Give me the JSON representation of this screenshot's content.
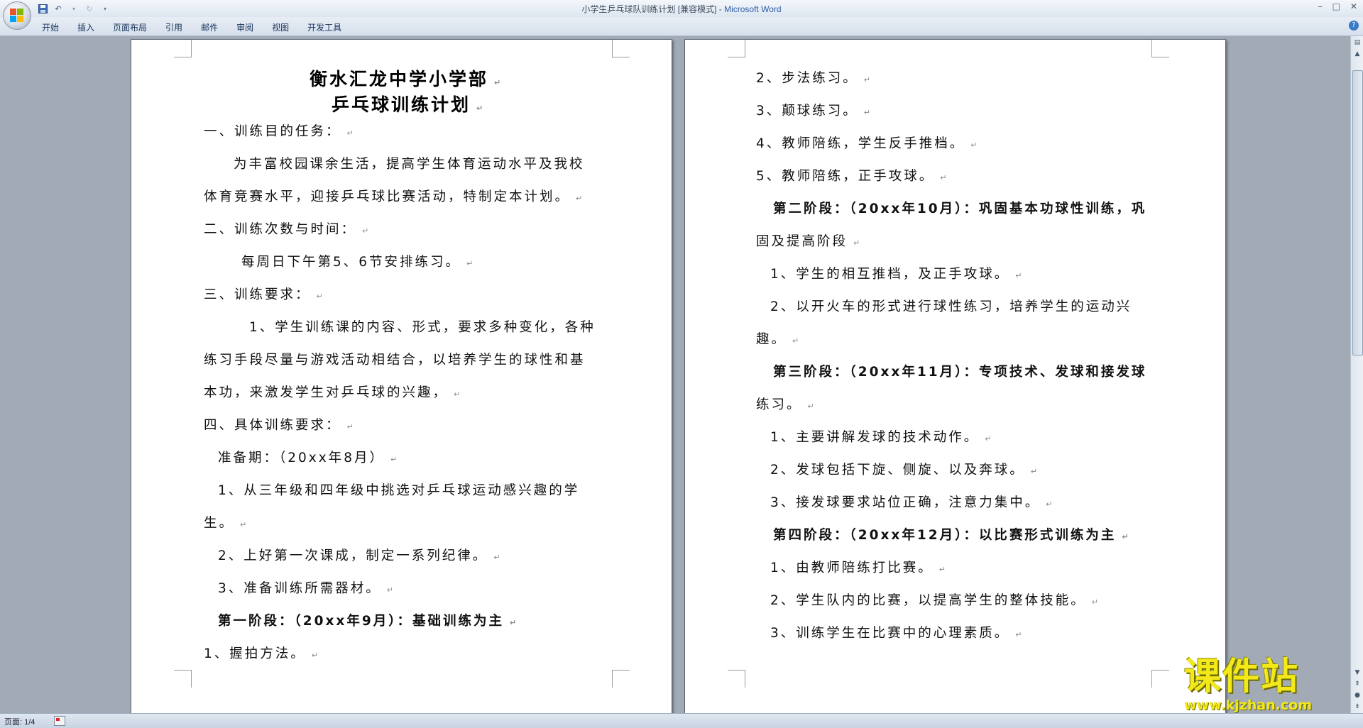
{
  "window": {
    "title_doc": "小学生乒乓球队训练计划 [兼容模式] - ",
    "title_app": "Microsoft Word",
    "controls": [
      "–",
      "□",
      "✕"
    ]
  },
  "ribbon": {
    "tabs": [
      "开始",
      "插入",
      "页面布局",
      "引用",
      "邮件",
      "审阅",
      "视图",
      "开发工具"
    ]
  },
  "document": {
    "left_page": {
      "title1": "衡水汇龙中学小学部",
      "title2": "乒乓球训练计划",
      "lines": [
        "一、训练目的任务：",
        "为丰富校园课余生活，提高学生体育运动水平及我校",
        "体育竞赛水平，迎接乒乓球比赛活动，特制定本计划。",
        "二、训练次数与时间：",
        "每周日下午第5、6节安排练习。",
        "三、训练要求：",
        "1、学生训练课的内容、形式，要求多种变化，各种",
        "练习手段尽量与游戏活动相结合，以培养学生的球性和基",
        "本功，来激发学生对乒乓球的兴趣，",
        "四、具体训练要求：",
        "准备期：（20xx年8月）",
        "1、从三年级和四年级中挑选对乒乓球运动感兴趣的学",
        "生。",
        "2、上好第一次课成，制定一系列纪律。",
        "3、准备训练所需器材。",
        "第一阶段：（20xx年9月）：基础训练为主",
        "1、握拍方法。"
      ]
    },
    "right_page": {
      "lines": [
        "2、步法练习。",
        "3、颠球练习。",
        "4、教师陪练，学生反手推档。",
        "5、教师陪练，正手攻球。",
        "第二阶段：（20xx年10月）：巩固基本功球性训练，巩",
        "固及提高阶段",
        "1、学生的相互推档，及正手攻球。",
        "2、以开火车的形式进行球性练习，培养学生的运动兴",
        "趣。",
        "第三阶段：（20xx年11月）：专项技术、发球和接发球",
        "练习。",
        "1、主要讲解发球的技术动作。",
        "2、发球包括下旋、侧旋、以及奔球。",
        "3、接发球要求站位正确，注意力集中。",
        "第四阶段：（20xx年12月）：以比赛形式训练为主",
        "1、由教师陪练打比赛。",
        "2、学生队内的比赛，以提高学生的整体技能。",
        "3、训练学生在比赛中的心理素质。"
      ]
    },
    "paragraph_mark": "↵"
  },
  "statusbar": {
    "page_info": "页面: 1/4"
  },
  "watermark": {
    "title": "课件站",
    "url": "www.kjzhan.com"
  }
}
